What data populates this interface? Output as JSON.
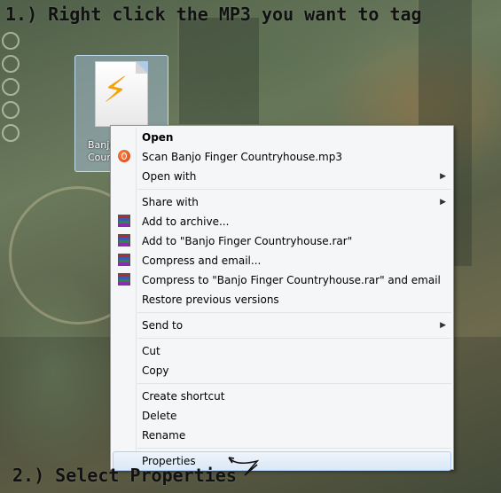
{
  "instructions": {
    "step1": "1.) Right click the MP3 you want to tag",
    "step2": "2.) Select Properties"
  },
  "desktop_icon": {
    "label_line1": "Banjo",
    "label_line2": "Coun",
    "icon": "winamp-file-icon"
  },
  "context_menu": {
    "items": [
      {
        "label": "Open",
        "bold": true
      },
      {
        "label": "Scan Banjo Finger Countryhouse.mp3",
        "icon": "scan-icon"
      },
      {
        "label": "Open with",
        "submenu": true
      },
      {
        "label": "Share with",
        "submenu": true
      },
      {
        "label": "Add to archive...",
        "icon": "winrar-icon"
      },
      {
        "label": "Add to \"Banjo Finger Countryhouse.rar\"",
        "icon": "winrar-icon"
      },
      {
        "label": "Compress and email...",
        "icon": "winrar-icon"
      },
      {
        "label": "Compress to \"Banjo Finger Countryhouse.rar\" and email",
        "icon": "winrar-icon"
      },
      {
        "label": "Restore previous versions"
      },
      {
        "label": "Send to",
        "submenu": true
      },
      {
        "label": "Cut"
      },
      {
        "label": "Copy"
      },
      {
        "label": "Create shortcut"
      },
      {
        "label": "Delete"
      },
      {
        "label": "Rename"
      },
      {
        "label": "Properties",
        "highlighted": true
      }
    ]
  },
  "colors": {
    "highlight_border": "#aecff7",
    "menu_bg": "#f5f6f7"
  }
}
